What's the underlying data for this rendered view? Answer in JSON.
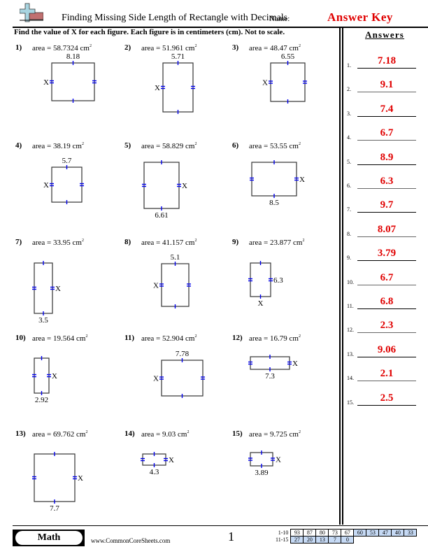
{
  "header": {
    "title": "Finding Missing Side Length of Rectangle with Decimals",
    "name_label": "Name:",
    "answer_key": "Answer Key",
    "logo_icon": "plus-on-bar-logo-icon"
  },
  "instructions": "Find the value of X for each figure. Each figure is in centimeters (cm). Not to scale.",
  "answers": {
    "title": "Answers",
    "items": [
      {
        "num": "1.",
        "value": "7.18"
      },
      {
        "num": "2.",
        "value": "9.1"
      },
      {
        "num": "3.",
        "value": "7.4"
      },
      {
        "num": "4.",
        "value": "6.7"
      },
      {
        "num": "5.",
        "value": "8.9"
      },
      {
        "num": "6.",
        "value": "6.3"
      },
      {
        "num": "7.",
        "value": "9.7"
      },
      {
        "num": "8.",
        "value": "8.07"
      },
      {
        "num": "9.",
        "value": "3.79"
      },
      {
        "num": "10.",
        "value": "6.7"
      },
      {
        "num": "11.",
        "value": "6.8"
      },
      {
        "num": "12.",
        "value": "2.3"
      },
      {
        "num": "13.",
        "value": "9.06"
      },
      {
        "num": "14.",
        "value": "2.1"
      },
      {
        "num": "15.",
        "value": "2.5"
      }
    ]
  },
  "problems": [
    {
      "num": "1)",
      "area": "area = 58.7324 cm",
      "unit_exp": "2",
      "known": "8.18",
      "known_side": "top",
      "x_side": "left"
    },
    {
      "num": "2)",
      "area": "area = 51.961 cm",
      "unit_exp": "2",
      "known": "5.71",
      "known_side": "top",
      "x_side": "left"
    },
    {
      "num": "3)",
      "area": "area = 48.47 cm",
      "unit_exp": "2",
      "known": "6.55",
      "known_side": "top",
      "x_side": "left"
    },
    {
      "num": "4)",
      "area": "area = 38.19 cm",
      "unit_exp": "2",
      "known": "5.7",
      "known_side": "top",
      "x_side": "left"
    },
    {
      "num": "5)",
      "area": "area = 58.829 cm",
      "unit_exp": "2",
      "known": "6.61",
      "known_side": "bottom",
      "x_side": "right"
    },
    {
      "num": "6)",
      "area": "area = 53.55 cm",
      "unit_exp": "2",
      "known": "8.5",
      "known_side": "bottom",
      "x_side": "right"
    },
    {
      "num": "7)",
      "area": "area = 33.95 cm",
      "unit_exp": "2",
      "known": "3.5",
      "known_side": "bottom",
      "x_side": "right"
    },
    {
      "num": "8)",
      "area": "area = 41.157 cm",
      "unit_exp": "2",
      "known": "5.1",
      "known_side": "top",
      "x_side": "left"
    },
    {
      "num": "9)",
      "area": "area = 23.877 cm",
      "unit_exp": "2",
      "known": "6.3",
      "known_side": "right",
      "x_side": "bottom"
    },
    {
      "num": "10)",
      "area": "area = 19.564 cm",
      "unit_exp": "2",
      "known": "2.92",
      "known_side": "bottom",
      "x_side": "right"
    },
    {
      "num": "11)",
      "area": "area = 52.904 cm",
      "unit_exp": "2",
      "known": "7.78",
      "known_side": "top",
      "x_side": "left"
    },
    {
      "num": "12)",
      "area": "area = 16.79 cm",
      "unit_exp": "2",
      "known": "7.3",
      "known_side": "bottom",
      "x_side": "right"
    },
    {
      "num": "13)",
      "area": "area = 69.762 cm",
      "unit_exp": "2",
      "known": "7.7",
      "known_side": "bottom",
      "x_side": "right"
    },
    {
      "num": "14)",
      "area": "area = 9.03 cm",
      "unit_exp": "2",
      "known": "4.3",
      "known_side": "bottom",
      "x_side": "right"
    },
    {
      "num": "15)",
      "area": "area = 9.725 cm",
      "unit_exp": "2",
      "known": "3.89",
      "known_side": "bottom",
      "x_side": "right"
    }
  ],
  "x_label": "X",
  "footer": {
    "subject": "Math",
    "website": "www.CommonCoreSheets.com",
    "page": "1",
    "score_rows": [
      {
        "label": "1-10",
        "cells": [
          "93",
          "87",
          "80",
          "73",
          "67",
          "60",
          "53",
          "47",
          "40",
          "33"
        ]
      },
      {
        "label": "11-15",
        "cells": [
          "27",
          "20",
          "13",
          "7",
          "0"
        ]
      }
    ]
  },
  "colors": {
    "answer_red": "#e00000",
    "tick_blue": "#0000ee",
    "score_blue": "#c6daf5"
  }
}
